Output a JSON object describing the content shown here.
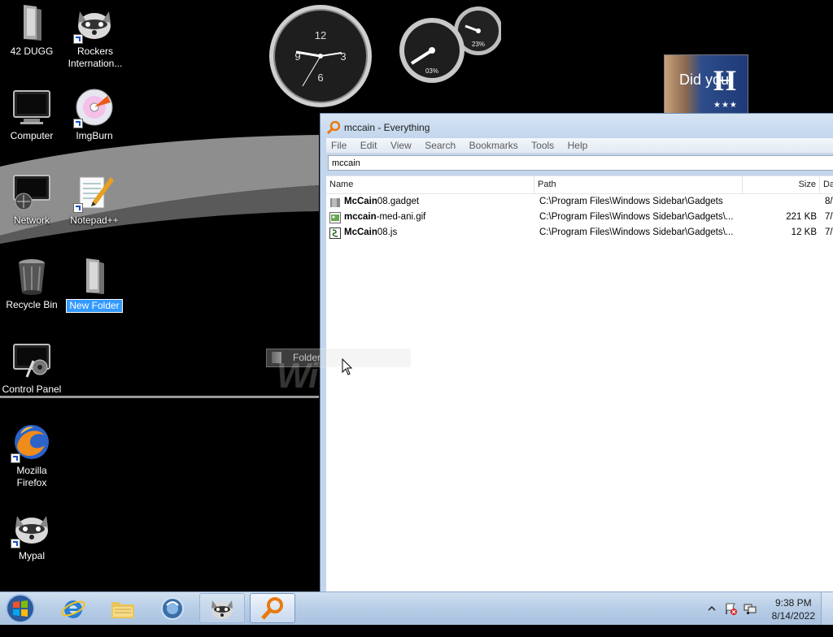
{
  "desktop": {
    "icons": [
      {
        "label": "42 DUGG",
        "icon": "folder-icon"
      },
      {
        "label": "Rockers Internation...",
        "icon": "raccoon-icon"
      },
      {
        "label": "Computer",
        "icon": "computer-icon"
      },
      {
        "label": "ImgBurn",
        "icon": "disc-icon"
      },
      {
        "label": "Network",
        "icon": "network-icon"
      },
      {
        "label": "Notepad++",
        "icon": "notepad-icon"
      },
      {
        "label": "Recycle Bin",
        "icon": "recycle-bin-icon"
      },
      {
        "label": "New Folder",
        "icon": "folder-icon"
      },
      {
        "label": "Control Panel",
        "icon": "control-panel-icon"
      },
      {
        "label": "Mozilla Firefox",
        "icon": "firefox-icon"
      },
      {
        "label": "Mypal",
        "icon": "raccoon-icon"
      }
    ],
    "clock_gadget": {
      "numerals": [
        "12",
        "3",
        "6",
        "9"
      ]
    },
    "cpu_gadget": {
      "cpu": "03%",
      "ram": "23%"
    },
    "slideshow_gadget": {
      "text": "Did you",
      "badge": "H",
      "stars": "★★★"
    },
    "drag_ghost": {
      "label": "Folder"
    }
  },
  "everything": {
    "title": "mccain - Everything",
    "menu": [
      "File",
      "Edit",
      "View",
      "Search",
      "Bookmarks",
      "Tools",
      "Help"
    ],
    "search_value": "mccain",
    "columns": {
      "name": "Name",
      "path": "Path",
      "size": "Size",
      "date": "Da"
    },
    "rows": [
      {
        "name_bold": "McCain",
        "name_rest": "08.gadget",
        "path": "C:\\Program Files\\Windows Sidebar\\Gadgets",
        "size": "",
        "date": "8/",
        "icon": "gadget-file-icon"
      },
      {
        "name_bold": "mccain",
        "name_rest": "-med-ani.gif",
        "path": "C:\\Program Files\\Windows Sidebar\\Gadgets\\...",
        "size": "221 KB",
        "date": "7/",
        "icon": "image-file-icon"
      },
      {
        "name_bold": "McCain",
        "name_rest": "08.js",
        "path": "C:\\Program Files\\Windows Sidebar\\Gadgets\\...",
        "size": "12 KB",
        "date": "7/",
        "icon": "script-file-icon"
      }
    ]
  },
  "taskbar": {
    "buttons": [
      "internet-explorer-icon",
      "windows-explorer-icon",
      "media-icon",
      "raccoon-icon",
      "everything-search-icon"
    ],
    "time": "9:38 PM",
    "date": "8/14/2022"
  }
}
